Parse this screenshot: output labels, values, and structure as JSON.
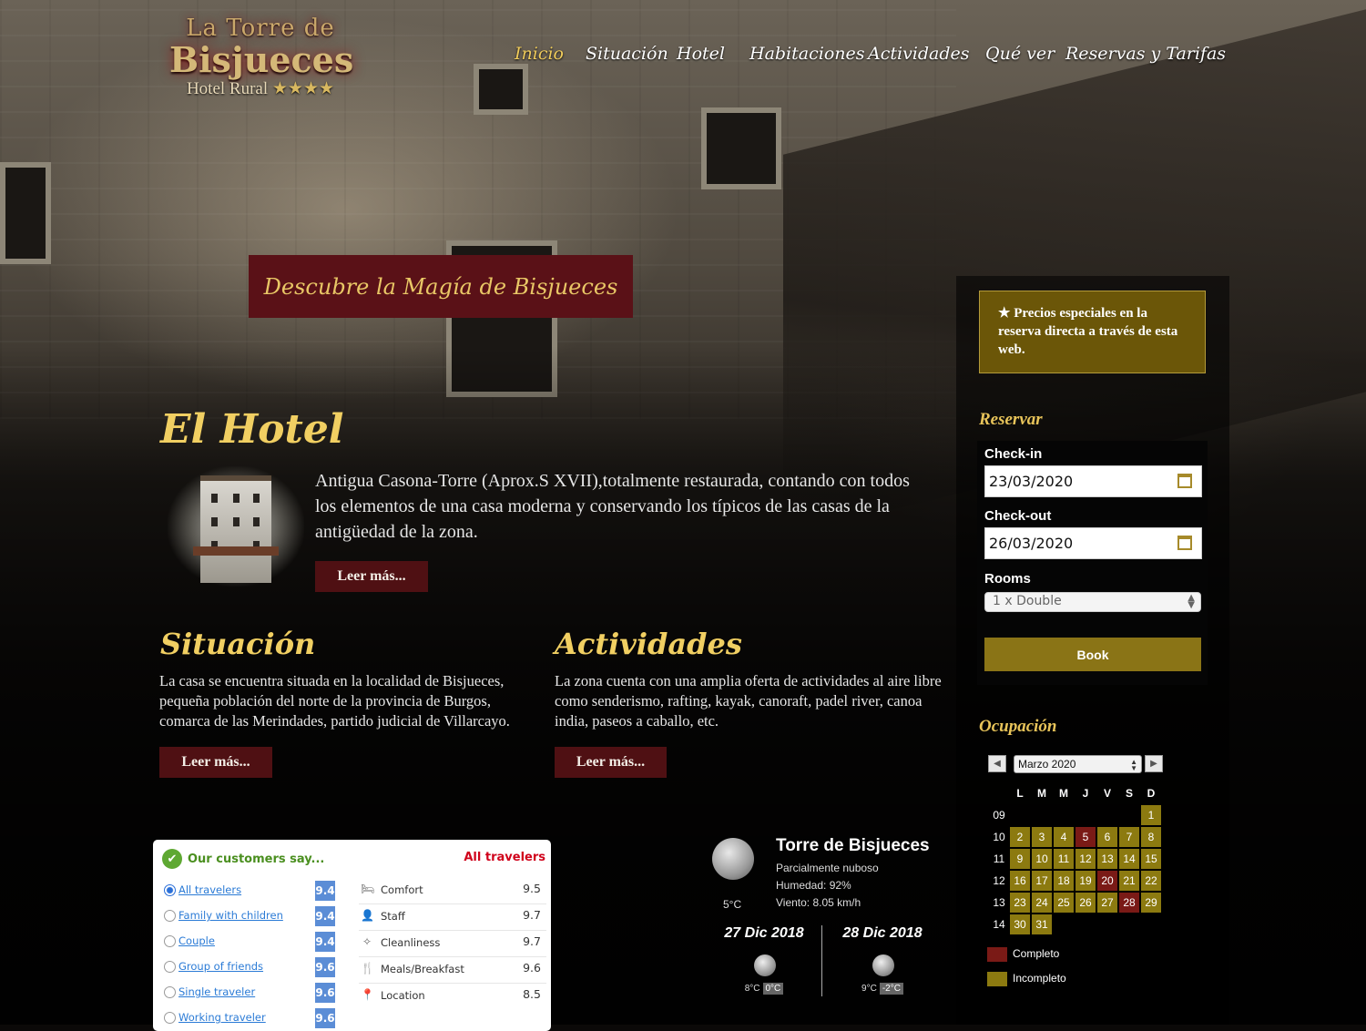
{
  "logo": {
    "line1": "La Torre de",
    "line2": "Bisjueces",
    "line3": "Hotel Rural",
    "stars": "★★★★"
  },
  "nav": [
    {
      "label": "Inicio",
      "active": true
    },
    {
      "label": "Situación"
    },
    {
      "label": "Hotel"
    },
    {
      "label": "Habitaciones"
    },
    {
      "label": "Actividades"
    },
    {
      "label": "Qué ver"
    },
    {
      "label": "Reservas y Tarifas"
    }
  ],
  "tagline": "Descubre la Magía de Bisjueces",
  "hotel": {
    "title": "El Hotel",
    "text": "Antigua Casona-Torre (Aprox.S XVII),totalmente restaurada, contando con todos los elementos de una casa moderna y conservando los típicos de las casas de la antigüedad de la zona.",
    "more": "Leer más..."
  },
  "situacion": {
    "title": "Situación",
    "text": "La casa se encuentra situada en la localidad de Bisjueces, pequeña población del norte de la provincia de Burgos, comarca de las Merindades, partido judicial de Villarcayo.",
    "more": "Leer más..."
  },
  "actividades": {
    "title": "Actividades",
    "text": "La zona cuenta con una amplia oferta de actividades al aire libre como senderismo, rafting, kayak, canoraft, padel river, canoa india, paseos a caballo, etc.",
    "more": "Leer más..."
  },
  "reviews": {
    "header": "Our customers say...",
    "selected": "All travelers",
    "groups": [
      {
        "label": "All travelers",
        "score": "9.4",
        "checked": true
      },
      {
        "label": "Family with children",
        "score": "9.4"
      },
      {
        "label": "Couple",
        "score": "9.4"
      },
      {
        "label": "Group of friends",
        "score": "9.6"
      },
      {
        "label": "Single traveler",
        "score": "9.6"
      },
      {
        "label": "Working traveler",
        "score": "9.6"
      }
    ],
    "categories": [
      {
        "icon": "bed-icon",
        "name": "Comfort",
        "value": "9.5"
      },
      {
        "icon": "person-icon",
        "name": "Staff",
        "value": "9.7"
      },
      {
        "icon": "sparkle-icon",
        "name": "Cleanliness",
        "value": "9.7"
      },
      {
        "icon": "cutlery-icon",
        "name": "Meals/Breakfast",
        "value": "9.6"
      },
      {
        "icon": "location-pin-icon",
        "name": "Location",
        "value": "8.5"
      }
    ]
  },
  "weather": {
    "place": "Torre de Bisjueces",
    "condition": "Parcialmente nuboso",
    "humidity": "Humedad: 92%",
    "wind": "Viento: 8.05 km/h",
    "temp": "5°C",
    "days": [
      {
        "date": "27 Dic 2018",
        "max": "8°C",
        "min": "0°C"
      },
      {
        "date": "28 Dic 2018",
        "max": "9°C",
        "min": "-2°C"
      }
    ]
  },
  "sidebar": {
    "promo": "★ Precios especiales en la reserva directa a través de esta web.",
    "reservar": "Reservar",
    "checkin_label": "Check-in",
    "checkin_value": "23/03/2020",
    "checkout_label": "Check-out",
    "checkout_value": "26/03/2020",
    "rooms_label": "Rooms",
    "rooms_value": "1 x Double",
    "book": "Book",
    "ocupacion": "Ocupación"
  },
  "calendar": {
    "month": "Marzo 2020",
    "dow": [
      "L",
      "M",
      "M",
      "J",
      "V",
      "S",
      "D"
    ],
    "weeks": [
      {
        "wk": "09",
        "days": [
          null,
          null,
          null,
          null,
          null,
          null,
          {
            "d": "1",
            "s": "inc"
          }
        ]
      },
      {
        "wk": "10",
        "days": [
          {
            "d": "2",
            "s": "inc"
          },
          {
            "d": "3",
            "s": "inc"
          },
          {
            "d": "4",
            "s": "inc"
          },
          {
            "d": "5",
            "s": "full"
          },
          {
            "d": "6",
            "s": "inc"
          },
          {
            "d": "7",
            "s": "inc"
          },
          {
            "d": "8",
            "s": "inc"
          }
        ]
      },
      {
        "wk": "11",
        "days": [
          {
            "d": "9",
            "s": "inc"
          },
          {
            "d": "10",
            "s": "inc"
          },
          {
            "d": "11",
            "s": "inc"
          },
          {
            "d": "12",
            "s": "inc"
          },
          {
            "d": "13",
            "s": "inc"
          },
          {
            "d": "14",
            "s": "inc"
          },
          {
            "d": "15",
            "s": "inc"
          }
        ]
      },
      {
        "wk": "12",
        "days": [
          {
            "d": "16",
            "s": "inc"
          },
          {
            "d": "17",
            "s": "inc"
          },
          {
            "d": "18",
            "s": "inc"
          },
          {
            "d": "19",
            "s": "inc"
          },
          {
            "d": "20",
            "s": "full"
          },
          {
            "d": "21",
            "s": "inc"
          },
          {
            "d": "22",
            "s": "inc"
          }
        ]
      },
      {
        "wk": "13",
        "days": [
          {
            "d": "23",
            "s": "inc"
          },
          {
            "d": "24",
            "s": "inc"
          },
          {
            "d": "25",
            "s": "inc"
          },
          {
            "d": "26",
            "s": "inc"
          },
          {
            "d": "27",
            "s": "inc"
          },
          {
            "d": "28",
            "s": "full"
          },
          {
            "d": "29",
            "s": "inc"
          }
        ]
      },
      {
        "wk": "14",
        "days": [
          {
            "d": "30",
            "s": "inc"
          },
          {
            "d": "31",
            "s": "inc"
          },
          null,
          null,
          null,
          null,
          null
        ]
      }
    ],
    "legend": [
      {
        "label": "Completo",
        "color": "#7a1a16"
      },
      {
        "label": "Incompleto",
        "color": "#8c7a10"
      }
    ]
  }
}
